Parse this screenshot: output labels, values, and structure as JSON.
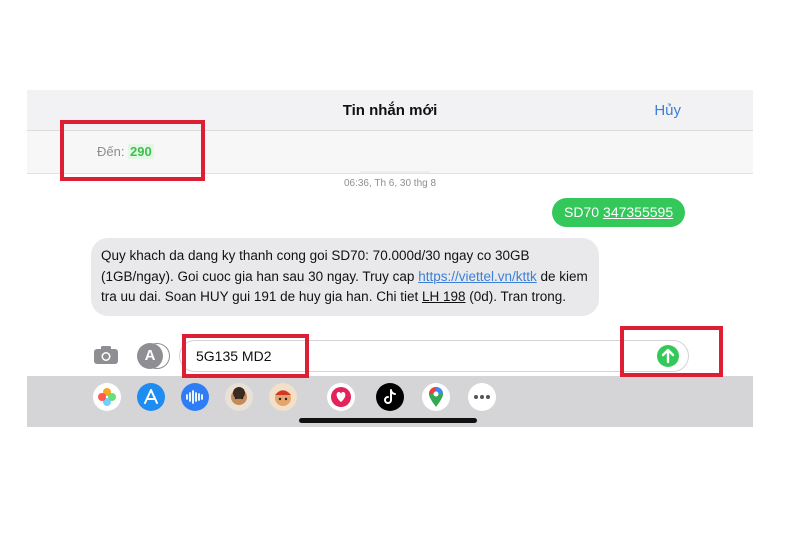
{
  "header": {
    "title": "Tin nhắn mới",
    "cancel_label": "Hủy"
  },
  "recipient": {
    "label": "Đến:",
    "value": "290"
  },
  "conversation": {
    "timestamp": "06:36, Th 6, 30 thg 8",
    "outgoing": {
      "keyword": "SD70",
      "number": "347355595"
    },
    "incoming": {
      "text_before_link": "Quy khach da dang ky thanh cong goi SD70: 70.000d/30 ngay co 30GB (1GB/ngay). Goi cuoc gia han sau 30 ngay. Truy cap ",
      "link": "https://viettel.vn/kttk",
      "text_middle": " de kiem tra uu dai. Soan HUY gui 191 de huy gia han. Chi tiet ",
      "lh": "LH 198",
      "text_end": " (0d). Tran trong."
    }
  },
  "composer": {
    "value": "5G135 MD2"
  },
  "dock": {
    "apps": [
      "photos-icon",
      "app-store-icon",
      "audio-message-icon",
      "memoji-icon",
      "memoji-2-icon",
      "digital-touch-icon",
      "tiktok-icon",
      "maps-icon",
      "more-icon"
    ]
  },
  "colors": {
    "accent_green": "#34c759",
    "link_blue": "#3a7fd8",
    "highlight_red": "#dc1f33"
  }
}
